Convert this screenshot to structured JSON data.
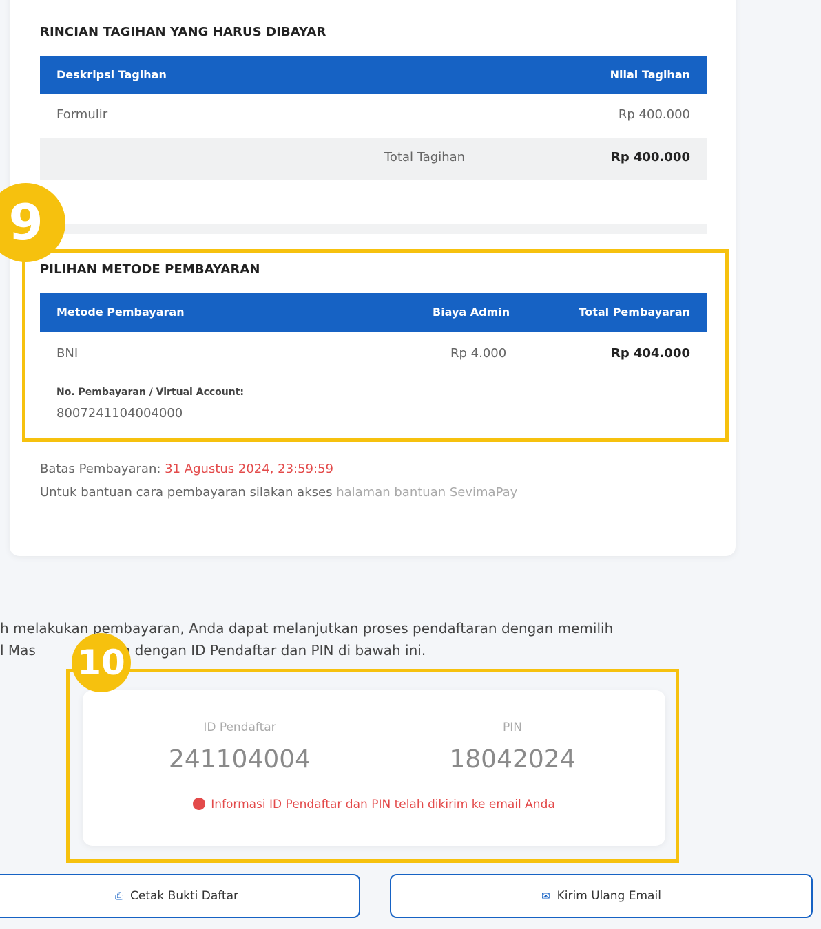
{
  "billing": {
    "title": "RINCIAN TAGIHAN YANG HARUS DIBAYAR",
    "col_desc": "Deskripsi Tagihan",
    "col_value": "Nilai Tagihan",
    "items": [
      {
        "desc": "Formulir",
        "value": "Rp 400.000"
      }
    ],
    "total_label": "Total Tagihan",
    "total_value": "Rp 400.000"
  },
  "payment": {
    "badge": "9",
    "title": "PILIHAN METODE PEMBAYARAN",
    "col_method": "Metode Pembayaran",
    "col_admin": "Biaya Admin",
    "col_total": "Total Pembayaran",
    "method": "BNI",
    "admin_fee": "Rp 4.000",
    "total": "Rp 404.000",
    "va_label": "No. Pembayaran / Virtual Account:",
    "va_number": "8007241104004000",
    "deadline_label": "Batas Pembayaran:",
    "deadline_value": "31 Agustus 2024, 23:59:59",
    "help_text": "Untuk bantuan cara pembayaran silakan akses",
    "help_link": "halaman bantuan SevimaPay"
  },
  "info": {
    "line1": "h melakukan pembayaran, Anda dapat melanjutkan proses pendaftaran dengan memilih",
    "line2_a": "l Mas",
    "line2_b": "n dengan ID Pendaftar dan PIN di bawah ini."
  },
  "credentials": {
    "badge": "10",
    "id_label": "ID Pendaftar",
    "id_value": "241104004",
    "pin_label": "PIN",
    "pin_value": "18042024",
    "notice": "Informasi ID Pendaftar dan PIN telah dikirim ke email Anda"
  },
  "buttons": {
    "print": "Cetak Bukti Daftar",
    "resend": "Kirim Ulang Email"
  },
  "colors": {
    "primary": "#1662c4",
    "highlight": "#f6c10e",
    "alert": "#e34a4a"
  },
  "icons": [
    "printer-icon",
    "envelope-icon",
    "alert-dot-icon"
  ]
}
